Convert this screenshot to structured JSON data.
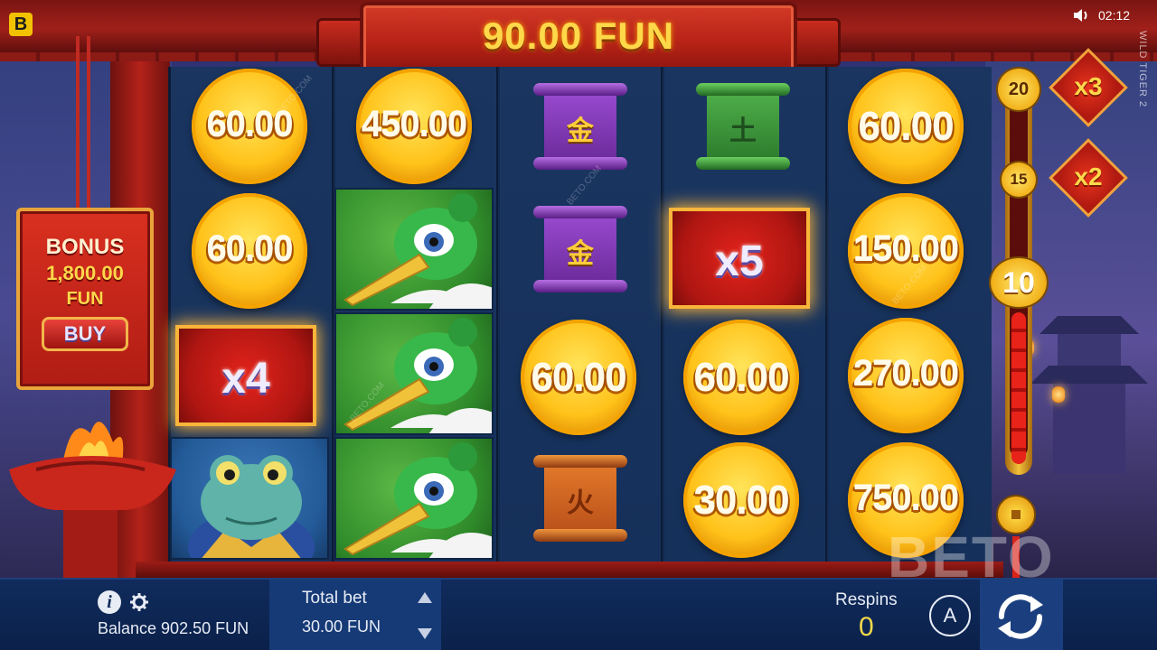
{
  "header": {
    "logo_letter": "B",
    "clock": "02:12",
    "game_name": "WILD TIGER 2"
  },
  "win_banner": {
    "amount": "90.00 FUN"
  },
  "reels": {
    "col1": {
      "coin1": "60.00",
      "coin2": "60.00",
      "multiplier": "x4"
    },
    "col2": {
      "coin1": "450.00"
    },
    "col3": {
      "scroll1_glyph": "金",
      "scroll2_glyph": "金",
      "coin1": "60.00",
      "scroll3_glyph": "火"
    },
    "col4": {
      "scroll1_glyph": "土",
      "multiplier": "x5",
      "coin1": "60.00",
      "coin2": "30.00"
    },
    "col5": {
      "coin1": "60.00",
      "coin2": "150.00",
      "coin3": "270.00",
      "coin4": "750.00"
    }
  },
  "bonus_buy": {
    "title": "BONUS",
    "price": "1,800.00",
    "currency": "FUN",
    "button": "BUY"
  },
  "multiplier_meter": {
    "marks": [
      "20",
      "15",
      "10"
    ],
    "active_mark": "10",
    "fill_fraction": 0.42,
    "side_multipliers": [
      "x3",
      "x2"
    ]
  },
  "watermark": {
    "text": "BETO",
    "small": "BETO.COM"
  },
  "bottom_bar": {
    "balance_label": "Balance 902.50 FUN",
    "total_bet_label": "Total bet",
    "total_bet_value": "30.00 FUN",
    "respins_label": "Respins",
    "respins_value": "0",
    "auto_label": "A"
  },
  "colors": {
    "accent_gold": "#ffd84a",
    "frame_red": "#b62216",
    "bar_navy": "#0b214a"
  },
  "icons": [
    "sound-icon",
    "info-icon",
    "gear-icon",
    "arrow-up-icon",
    "arrow-down-icon",
    "autoplay-icon",
    "spin-icon"
  ]
}
